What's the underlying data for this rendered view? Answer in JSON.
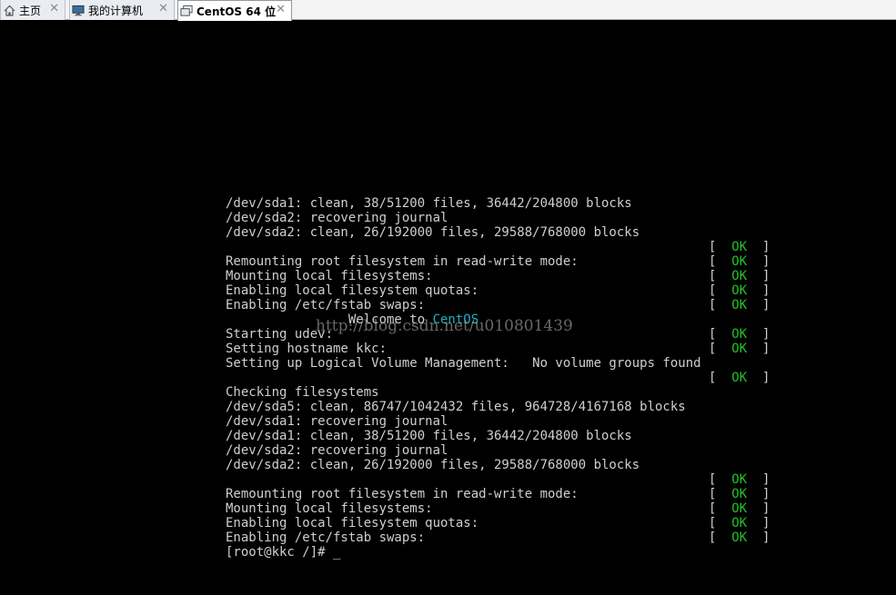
{
  "tabs": [
    {
      "label": "主页",
      "icon": "home-icon",
      "close": "✕"
    },
    {
      "label": "我的计算机",
      "icon": "computer-icon",
      "close": "✕"
    },
    {
      "label": "CentOS 64 位",
      "icon": "vm-icon",
      "close": "✕",
      "active": true
    }
  ],
  "console": {
    "lines": [
      {
        "text": "/dev/sda1: clean, 38/51200 files, 36442/204800 blocks"
      },
      {
        "text": "/dev/sda2: recovering journal"
      },
      {
        "text": "/dev/sda2: clean, 26/192000 files, 29588/768000 blocks"
      },
      {
        "text": "",
        "status": "OK"
      },
      {
        "text": "Remounting root filesystem in read-write mode:",
        "status": "OK"
      },
      {
        "text": "Mounting local filesystems:",
        "status": "OK"
      },
      {
        "text": "Enabling local filesystem quotas:",
        "status": "OK"
      },
      {
        "text": "Enabling /etc/fstab swaps:",
        "status": "OK"
      },
      {
        "text": "                Welcome to ",
        "highlight": "CentOS"
      },
      {
        "text": "Starting udev:",
        "status": "OK"
      },
      {
        "text": "Setting hostname kkc:",
        "status": "OK"
      },
      {
        "text": "Setting up Logical Volume Management:   No volume groups found"
      },
      {
        "text": "",
        "status": "OK"
      },
      {
        "text": "Checking filesystems"
      },
      {
        "text": "/dev/sda5: clean, 86747/1042432 files, 964728/4167168 blocks"
      },
      {
        "text": "/dev/sda1: recovering journal"
      },
      {
        "text": "/dev/sda1: clean, 38/51200 files, 36442/204800 blocks"
      },
      {
        "text": "/dev/sda2: recovering journal"
      },
      {
        "text": "/dev/sda2: clean, 26/192000 files, 29588/768000 blocks"
      },
      {
        "text": "",
        "status": "OK"
      },
      {
        "text": "Remounting root filesystem in read-write mode:",
        "status": "OK"
      },
      {
        "text": "Mounting local filesystems:",
        "status": "OK"
      },
      {
        "text": "Enabling local filesystem quotas:",
        "status": "OK"
      },
      {
        "text": "Enabling /etc/fstab swaps:",
        "status": "OK"
      }
    ],
    "prompt": "[root@kkc /]# ",
    "cursor": "_"
  },
  "watermark": "http://blog.csdn.net/u010801439",
  "colors": {
    "ok": "#22c322",
    "centos": "#1fb0c0",
    "text": "#cfcfcf",
    "background": "#000000"
  }
}
